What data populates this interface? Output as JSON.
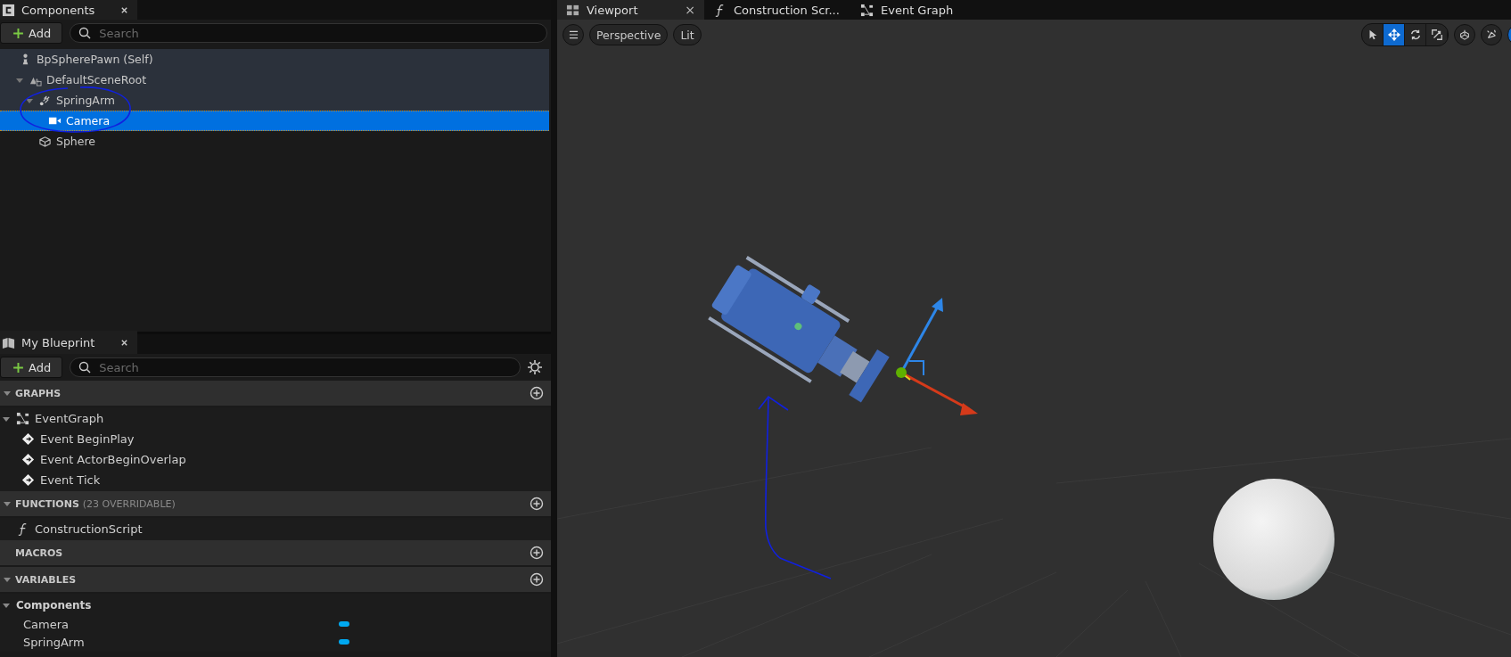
{
  "components": {
    "tab": {
      "title": "Components"
    },
    "add_button": "Add",
    "search": {
      "placeholder": "Search"
    },
    "tree": [
      {
        "label": "BpSpherePawn (Self)",
        "kind": "pawn",
        "selected": false,
        "children": [
          {
            "label": "DefaultSceneRoot",
            "kind": "scene",
            "selected": false,
            "expanded": true,
            "children": [
              {
                "label": "SpringArm",
                "kind": "spring",
                "selected": false,
                "expanded": true,
                "children": [
                  {
                    "label": "Camera",
                    "kind": "camera",
                    "selected": true
                  }
                ]
              },
              {
                "label": "Sphere",
                "kind": "mesh",
                "selected": false
              }
            ]
          }
        ]
      }
    ]
  },
  "my_blueprint": {
    "tab": {
      "title": "My Blueprint"
    },
    "add_button": "Add",
    "search": {
      "placeholder": "Search"
    },
    "sections": [
      {
        "title": "GRAPHS",
        "expanded": true,
        "items": [
          {
            "label": "EventGraph",
            "kind": "graph",
            "expanded": true,
            "children": [
              {
                "label": "Event BeginPlay",
                "kind": "event"
              },
              {
                "label": "Event ActorBeginOverlap",
                "kind": "event"
              },
              {
                "label": "Event Tick",
                "kind": "event"
              }
            ]
          }
        ]
      },
      {
        "title": "FUNCTIONS",
        "note": "(23 OVERRIDABLE)",
        "expanded": true,
        "items": [
          {
            "label": "ConstructionScript",
            "kind": "function"
          }
        ]
      },
      {
        "title": "MACROS"
      },
      {
        "title": "VARIABLES",
        "expanded": true,
        "items": [
          {
            "label": "Components",
            "kind": "category",
            "expanded": true,
            "children": [
              {
                "label": "Camera",
                "kind": "variable"
              },
              {
                "label": "SpringArm",
                "kind": "variable"
              }
            ]
          }
        ]
      }
    ]
  },
  "editor_tabs": [
    {
      "label": "Viewport",
      "kind": "viewport",
      "selected": true,
      "close": "×"
    },
    {
      "label": "Construction Scr...",
      "kind": "function",
      "selected": false
    },
    {
      "label": "Event Graph",
      "kind": "graph",
      "selected": false
    }
  ],
  "viewport": {
    "view_buttons": [
      "Perspective",
      "Lit"
    ],
    "transform_tools": [
      {
        "kind": "select",
        "selected": false
      },
      {
        "kind": "translate",
        "selected": true
      },
      {
        "kind": "rotate",
        "selected": false
      },
      {
        "kind": "scale",
        "selected": false
      }
    ],
    "toggles": [
      {
        "kind": "surface",
        "selected": false
      },
      {
        "kind": "local",
        "selected": false
      },
      {
        "kind": "grid",
        "selected": true
      }
    ]
  }
}
